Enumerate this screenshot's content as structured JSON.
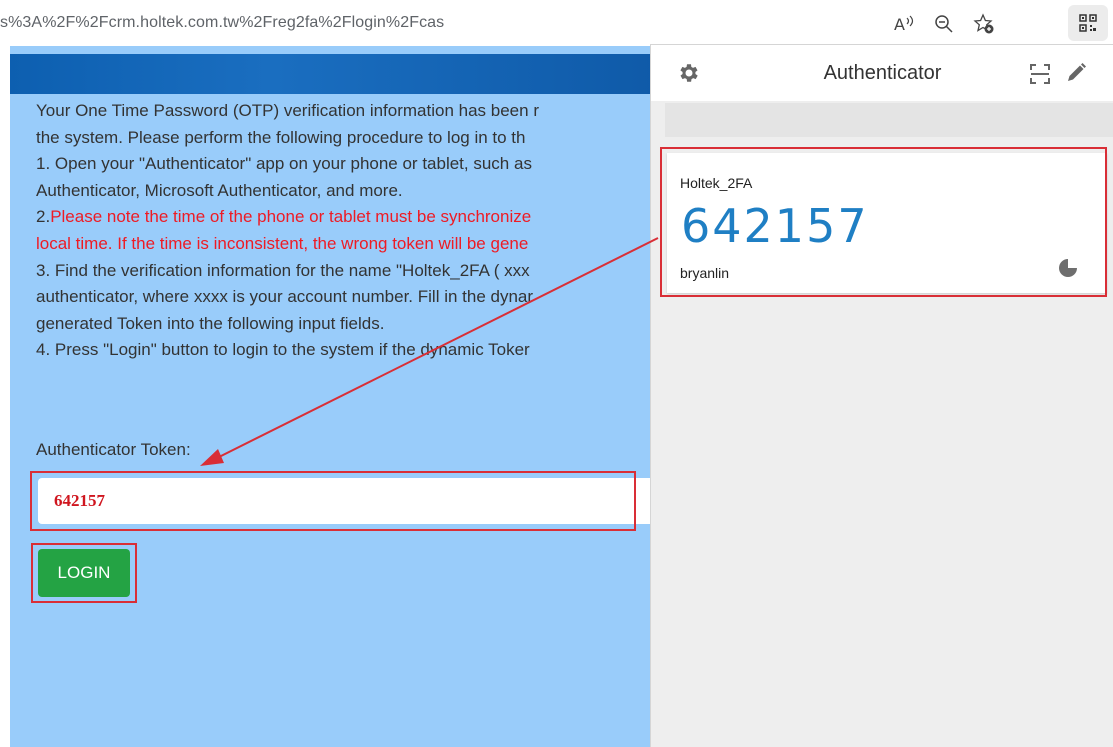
{
  "browser": {
    "url": "s%3A%2F%2Fcrm.holtek.com.tw%2Freg2fa%2Flogin%2Fcas",
    "icons": [
      "read-aloud-icon",
      "zoom-out-icon",
      "add-favorite-icon",
      "qr-extension-icon"
    ]
  },
  "page": {
    "instructions": {
      "line1": "Your One Time Password (OTP) verification information has been r",
      "line2": "the system. Please perform the following procedure to log in to th",
      "line3": "1. Open your \"Authenticator\" app on your phone or tablet, such as",
      "line4": "Authenticator, Microsoft Authenticator, and more.",
      "line5_prefix": "2.",
      "line5_red": "Please note the time of the phone or tablet must be synchronize",
      "line6_red": "local time. If the time is inconsistent, the wrong token will be gene",
      "line7": "3. Find the verification information for the name \"Holtek_2FA ( xxx",
      "line8": "authenticator, where xxxx is your account number. Fill in the dynar",
      "line9": "generated Token into the following input fields.",
      "line10": "4. Press \"Login\" button to login to the system if the dynamic Toker"
    },
    "token_label": "Authenticator Token:",
    "token_value": "642157",
    "login_label": "LOGIN"
  },
  "authenticator": {
    "title": "Authenticator",
    "entry": {
      "issuer": "Holtek_2FA",
      "code": "642157",
      "account": "bryanlin"
    }
  },
  "colors": {
    "page_bg": "#99ccfa",
    "login_bg": "#24a344",
    "code_blue": "#1f7fc4",
    "highlight_red": "#d92e36",
    "warning_red": "#ee1b24"
  }
}
